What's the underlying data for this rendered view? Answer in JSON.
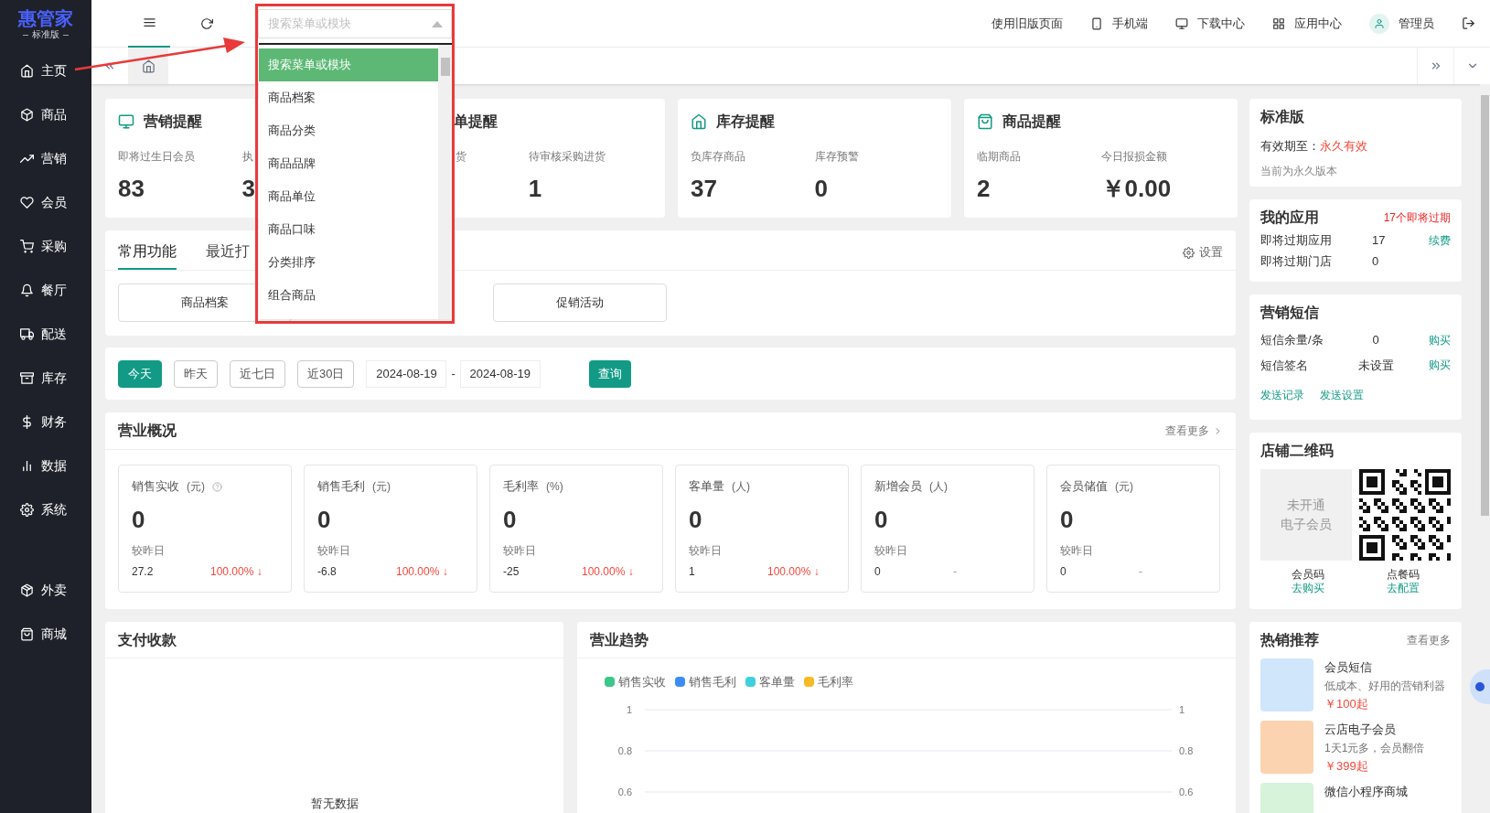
{
  "sidebar": {
    "logo": "惠管家",
    "edition": "标准版",
    "items": [
      {
        "label": "主页"
      },
      {
        "label": "商品"
      },
      {
        "label": "营销"
      },
      {
        "label": "会员"
      },
      {
        "label": "采购"
      },
      {
        "label": "餐厅"
      },
      {
        "label": "配送"
      },
      {
        "label": "库存"
      },
      {
        "label": "财务"
      },
      {
        "label": "数据"
      },
      {
        "label": "系统"
      }
    ],
    "extra_items": [
      {
        "label": "外卖"
      },
      {
        "label": "商城"
      }
    ]
  },
  "topbar": {
    "links": [
      "使用旧版页面",
      "手机端",
      "下载中心",
      "应用中心"
    ],
    "user": "管理员"
  },
  "search": {
    "placeholder": "搜索菜单或模块",
    "options": [
      {
        "label": "搜索菜单或模块",
        "selected": true
      },
      {
        "label": "商品档案",
        "selected": false
      },
      {
        "label": "商品分类",
        "selected": false
      },
      {
        "label": "商品品牌",
        "selected": false
      },
      {
        "label": "商品单位",
        "selected": false
      },
      {
        "label": "商品口味",
        "selected": false
      },
      {
        "label": "分类排序",
        "selected": false
      },
      {
        "label": "组合商品",
        "selected": false
      }
    ]
  },
  "alerts": [
    {
      "title": "营销提醒",
      "items": [
        {
          "label": "即将过生日会员",
          "value": "83"
        },
        {
          "label": "执",
          "value": "3"
        }
      ]
    },
    {
      "title": "单提醒",
      "items": [
        {
          "label": "货"
        },
        {
          "label": "待审核采购进货",
          "value": "1"
        }
      ]
    },
    {
      "title": "库存提醒",
      "items": [
        {
          "label": "负库存商品",
          "value": "37"
        },
        {
          "label": "库存预警",
          "value": "0"
        }
      ]
    },
    {
      "title": "商品提醒",
      "items": [
        {
          "label": "临期商品",
          "value": "2"
        },
        {
          "label": "今日报损金额",
          "value": "￥0.00"
        }
      ]
    }
  ],
  "shortcuts": {
    "tabs": [
      {
        "label": "常用功能",
        "selected": true
      },
      {
        "label": "最近打",
        "selected": false
      }
    ],
    "settings": "设置",
    "buttons": [
      {
        "label": "商品档案"
      },
      {
        "label": "促销活动"
      }
    ]
  },
  "date_filter": {
    "ranges": [
      {
        "label": "今天",
        "selected": true
      },
      {
        "label": "昨天",
        "selected": false
      },
      {
        "label": "近七日",
        "selected": false
      },
      {
        "label": "近30日",
        "selected": false
      }
    ],
    "start": "2024-08-19",
    "separator": "-",
    "end": "2024-08-19",
    "query": "查询"
  },
  "overview": {
    "title": "营业概况",
    "more": "查看更多",
    "metrics": [
      {
        "name": "销售实收",
        "unit": "(元)",
        "help": true,
        "value": "0",
        "compare_label": "较昨日",
        "yesterday": "27.2",
        "change": "100.00% ↓",
        "decreased": true
      },
      {
        "name": "销售毛利",
        "unit": "(元)",
        "help": false,
        "value": "0",
        "compare_label": "较昨日",
        "yesterday": "-6.8",
        "change": "100.00% ↓",
        "decreased": true
      },
      {
        "name": "毛利率",
        "unit": "(%)",
        "help": false,
        "value": "0",
        "compare_label": "较昨日",
        "yesterday": "-25",
        "change": "100.00% ↓",
        "decreased": true
      },
      {
        "name": "客单量",
        "unit": "(人)",
        "help": false,
        "value": "0",
        "compare_label": "较昨日",
        "yesterday": "1",
        "change": "100.00% ↓",
        "decreased": true
      },
      {
        "name": "新增会员",
        "unit": "(人)",
        "help": false,
        "value": "0",
        "compare_label": "较昨日",
        "yesterday": "0",
        "change": "-",
        "decreased": false
      },
      {
        "name": "会员储值",
        "unit": "(元)",
        "help": false,
        "value": "0",
        "compare_label": "较昨日",
        "yesterday": "0",
        "change": "-",
        "decreased": false
      }
    ]
  },
  "payments": {
    "title": "支付收款",
    "empty": "暂无数据"
  },
  "trend": {
    "title": "营业趋势",
    "chart_data": {
      "type": "line",
      "series": [
        {
          "name": "销售实收",
          "color": "#3cc68a"
        },
        {
          "name": "销售毛利",
          "color": "#3d8cf5"
        },
        {
          "name": "客单量",
          "color": "#3fcfdf"
        },
        {
          "name": "毛利率",
          "color": "#f7b924"
        }
      ],
      "ylim": [
        0.6,
        1
      ],
      "yticks": [
        1,
        0.8,
        0.6
      ]
    },
    "right_axis_ticks": [
      "1",
      "0.8",
      "0.6"
    ]
  },
  "edition_card": {
    "title": "标准版",
    "expiry_label": "有效期至：",
    "expiry": "永久有效",
    "note": "当前为永久版本"
  },
  "my_apps": {
    "title": "我的应用",
    "badge": "17个即将过期",
    "rows": [
      {
        "label": "即将过期应用",
        "value": "17",
        "action": "续费"
      },
      {
        "label": "即将过期门店",
        "value": "0"
      }
    ]
  },
  "sms": {
    "title": "营销短信",
    "rows": [
      {
        "label": "短信余量/条",
        "value": "0",
        "action": "购买"
      },
      {
        "label": "短信签名",
        "value": "未设置",
        "action": "购买"
      }
    ],
    "links": [
      "发送记录",
      "发送设置"
    ]
  },
  "store_qr": {
    "title": "店铺二维码",
    "placeholder_lines": [
      "未开通",
      "电子会员"
    ],
    "codes": [
      {
        "label": "会员码",
        "action": "去购买"
      },
      {
        "label": "点餐码",
        "action": "去配置"
      }
    ]
  },
  "hot": {
    "title": "热销推荐",
    "more": "查看更多",
    "items": [
      {
        "name": "会员短信",
        "desc": "低成本、好用的营销利器",
        "price": "￥100起",
        "color": "#cfe6fb"
      },
      {
        "name": "云店电子会员",
        "desc": "1天1元多，会员翻倍",
        "price": "￥399起",
        "color": "#fbd3b0"
      },
      {
        "name": "微信小程序商城",
        "color": "#d7f3d9"
      }
    ]
  }
}
